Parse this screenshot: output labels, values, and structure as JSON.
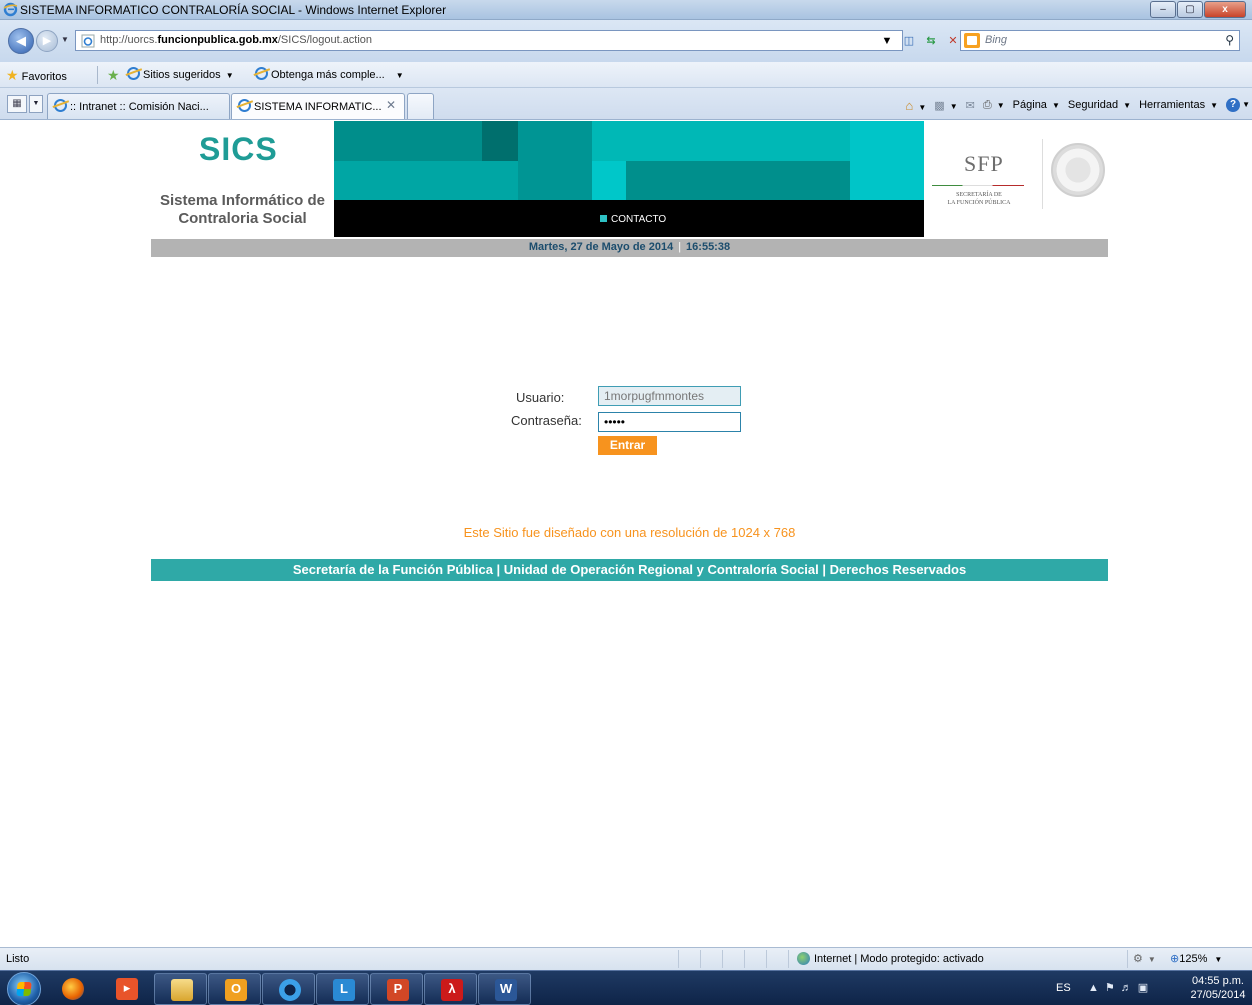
{
  "window": {
    "title": "SISTEMA INFORMATICO CONTRALORÍA SOCIAL - Windows Internet Explorer",
    "minimize_label": "–",
    "maximize_label": "▢",
    "close_label": "x"
  },
  "address": {
    "url_prefix": "http://uorcs.",
    "url_domain": "funcionpublica.gob.mx",
    "url_path": "/SICS/logout.action",
    "search_placeholder": "Bing"
  },
  "favorites_bar": {
    "favorites_label": "Favoritos",
    "suggested_sites_label": "Sitios sugeridos",
    "more_addons_label": "Obtenga más comple..."
  },
  "tabs": [
    {
      "label": ":: Intranet :: Comisión Naci...",
      "active": false
    },
    {
      "label": "SISTEMA INFORMATIC...",
      "active": true
    }
  ],
  "command_bar": {
    "page_label": "Página",
    "security_label": "Seguridad",
    "tools_label": "Herramientas"
  },
  "page": {
    "logo_text": "SICS",
    "system_name_line1": "Sistema Informático de",
    "system_name_line2": "Contraloria Social",
    "menu_contacto": "CONTACTO",
    "sfp_text": "SFP",
    "sfp_caption_line1": "SECRETARÍA DE",
    "sfp_caption_line2": "LA FUNCIÓN PÚBLICA",
    "date": "Martes, 27 de Mayo de 2014",
    "time": "16:55:38",
    "date_separator": "|",
    "brand_color": "#1f9c96",
    "accent_color": "#f7931e"
  },
  "login": {
    "user_label": "Usuario:",
    "user_value": "1morpugfmmontes",
    "password_label": "Contraseña:",
    "password_value": "•••••",
    "submit_label": "Entrar",
    "resolution_note": "Este Sitio fue diseñado con una resolución de 1024 x 768"
  },
  "footer": {
    "text": "Secretaría de la Función Pública | Unidad de Operación Regional y Contraloría Social | Derechos Reservados"
  },
  "status_bar": {
    "status": "Listo",
    "zone": "Internet | Modo protegido: activado",
    "zoom": "125%"
  },
  "taskbar": {
    "language": "ES",
    "time": "04:55 p.m.",
    "date": "27/05/2014"
  }
}
